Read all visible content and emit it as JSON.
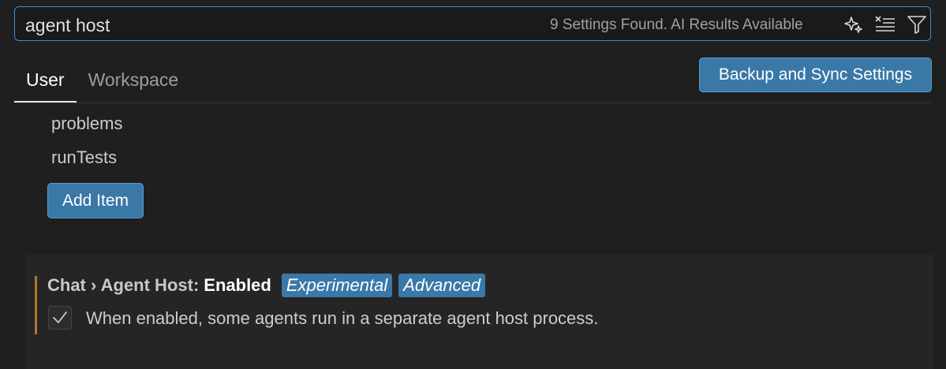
{
  "search": {
    "value": "agent host",
    "results_label": "9 Settings Found. AI Results Available",
    "icons": [
      "sparkle-icon",
      "clear-filter-icon",
      "filter-icon"
    ]
  },
  "tabs": [
    {
      "label": "User",
      "active": true
    },
    {
      "label": "Workspace",
      "active": false
    }
  ],
  "sync_button": {
    "label": "Backup and Sync Settings"
  },
  "list": {
    "items": [
      "problems",
      "runTests"
    ],
    "add_button": "Add Item"
  },
  "setting": {
    "category": "Chat › Agent Host:",
    "key": "Enabled",
    "tags": [
      "Experimental",
      "Advanced"
    ],
    "checked": true,
    "description": "When enabled, some agents run in a separate agent host process."
  },
  "colors": {
    "accent": "#3b8bd6",
    "button": "#3a78a8",
    "modified_bar": "#b07830",
    "background": "#1f1f1f"
  }
}
